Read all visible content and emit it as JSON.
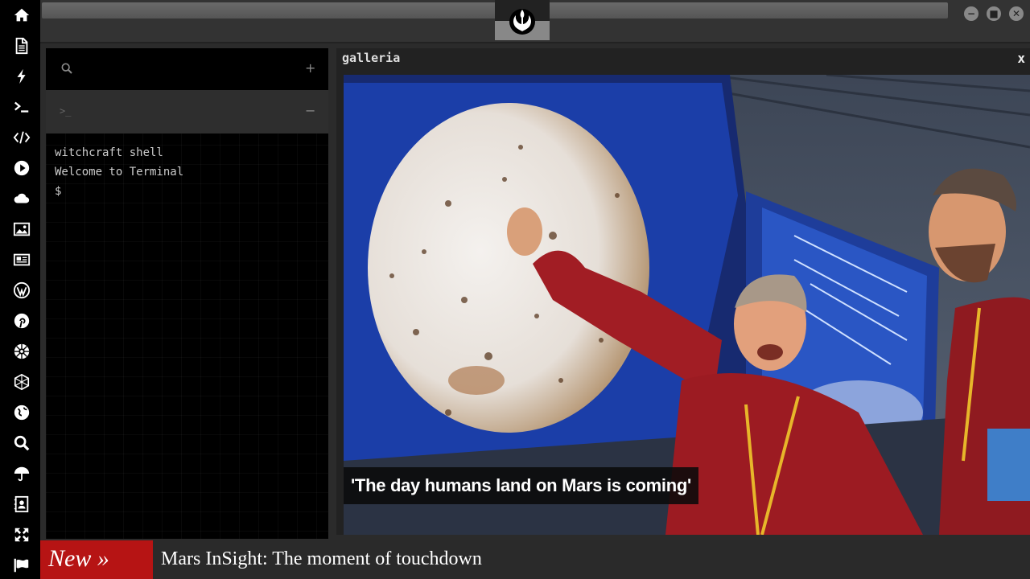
{
  "sidebar": {
    "icons": [
      "home-icon",
      "document-icon",
      "lightning-icon",
      "terminal-icon",
      "code-icon",
      "play-icon",
      "cloud-icon",
      "image-icon",
      "newspaper-icon",
      "wordpress-icon",
      "pinterest-icon",
      "galactic-empire-icon",
      "globe-wire-icon",
      "earth-icon",
      "search-icon",
      "umbrella-icon",
      "contact-card-icon",
      "expand-icon",
      "flag-icon"
    ]
  },
  "topbar": {
    "logo": "rebel-alliance-icon",
    "window_buttons": {
      "minimize": "−",
      "maximize": "■",
      "close": "✕"
    }
  },
  "terminal": {
    "search_icon": "search-icon",
    "add_label": "+",
    "tab_prompt": ">_",
    "collapse_label": "−",
    "lines": [
      "witchcraft shell",
      "Welcome to Terminal",
      "$"
    ]
  },
  "galleria": {
    "title": "galleria",
    "close_label": "x",
    "caption": "'The day humans land on Mars is coming'"
  },
  "ticker": {
    "badge": "New »",
    "headline": "Mars InSight: The moment of touchdown"
  },
  "colors": {
    "accent_red": "#b61414",
    "sidebar_bg": "#000000",
    "panel_bg": "#222222"
  }
}
